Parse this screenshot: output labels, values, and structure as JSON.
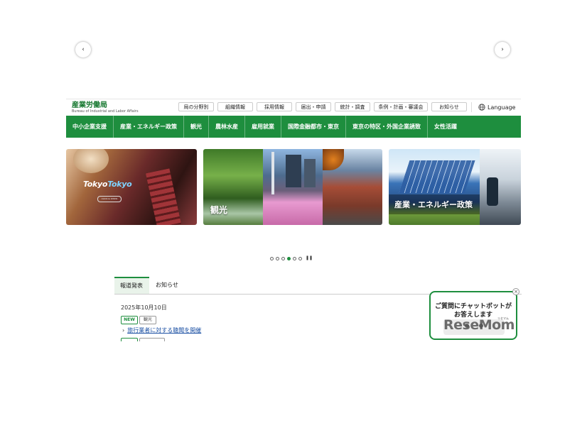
{
  "header": {
    "logo_jp": "産業労働局",
    "logo_en": "Bureau of Industrial and Labor Affairs",
    "top_links": [
      "局の分野別",
      "組織情報",
      "採用情報",
      "届出・申請",
      "統計・調査",
      "条例・計画・審議会",
      "お知らせ"
    ],
    "language": "Language"
  },
  "nav": {
    "items": [
      "中小企業支援",
      "産業・エネルギー政策",
      "観光",
      "農林水産",
      "雇用就業",
      "国際金融都市・東京",
      "東京の特区・外国企業誘致",
      "女性活躍"
    ]
  },
  "carousel": {
    "slide1_logo_a": "Tokyo",
    "slide1_logo_b": "Tokyo",
    "slide1_button": "CLICK & SHOW",
    "slide2_caption": "観光",
    "slide3_caption": "産業・エネルギー政策",
    "prev_arrow": "‹",
    "next_arrow": "›",
    "dot_count": 6,
    "active_dot": 4,
    "pause_symbol": "❚❚"
  },
  "news": {
    "tabs": [
      "報道発表",
      "お知らせ"
    ],
    "date": "2025年10月10日",
    "badge_new": "NEW",
    "category": "観光",
    "link_chevron": "›",
    "link_text": "旅行業者に対する聴聞を開催"
  },
  "chatbot": {
    "line1": "ご質問にチャットボットが",
    "line2": "お答えします",
    "close": "×"
  },
  "watermark": {
    "text": "ReseMom",
    "sub": "リセマム"
  }
}
